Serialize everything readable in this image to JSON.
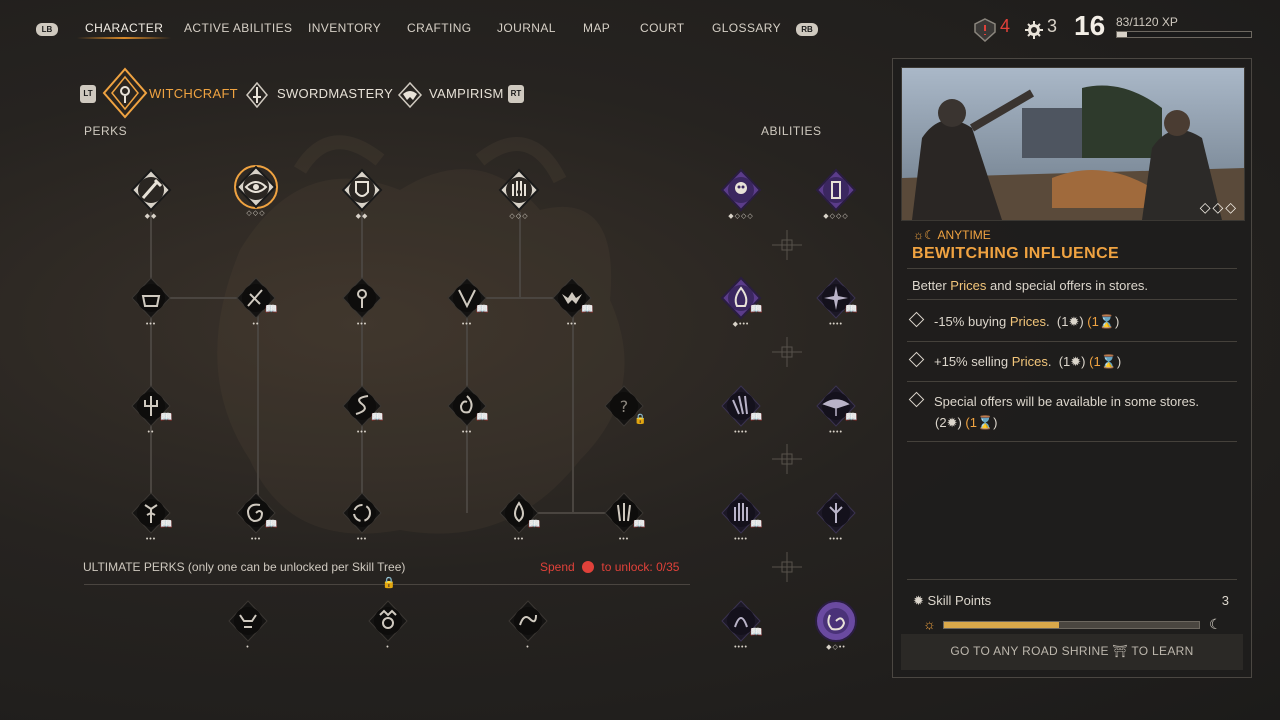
{
  "top_nav": {
    "left_bumper": "LB",
    "right_bumper": "RB",
    "tabs": [
      "CHARACTER",
      "ACTIVE ABILITIES",
      "INVENTORY",
      "CRAFTING",
      "JOURNAL",
      "MAP",
      "COURT",
      "GLOSSARY"
    ],
    "active_tab": "CHARACTER"
  },
  "stats": {
    "alert_count": "4",
    "skill_points": "3",
    "level": "16",
    "xp": "83/1120 XP",
    "xp_fraction": 0.074
  },
  "tree_tabs": {
    "left_trigger": "LT",
    "right_trigger": "RT",
    "items": [
      "WITCHCRAFT",
      "SWORDMASTERY",
      "VAMPIRISM"
    ],
    "active": "WITCHCRAFT"
  },
  "labels": {
    "perks": "PERKS",
    "abilities": "ABILITIES",
    "ultimate": "ULTIMATE PERKS (only one can be unlocked per Skill Tree)",
    "spend_prefix": "Spend",
    "spend_suffix": "to unlock: 0/35"
  },
  "detail": {
    "timing": "ANYTIME",
    "title": "BEWITCHING INFLUENCE",
    "desc_pre": "Better ",
    "desc_hl": "Prices",
    "desc_post": " and special offers in stores.",
    "effects": [
      {
        "pre": "-15% buying ",
        "hl": "Prices",
        "post": ".",
        "cost": "(1",
        "time": "(1"
      },
      {
        "pre": "+15% selling ",
        "hl": "Prices",
        "post": ".",
        "cost": "(1",
        "time": "(1"
      },
      {
        "pre": "Special offers will be available in some stores.",
        "hl": "",
        "post": "",
        "cost": "(2",
        "time": "(1"
      }
    ],
    "skill_points_label": "Skill Points",
    "skill_points_value": "3",
    "footer_pre": "GO TO ANY ROAD SHRINE",
    "footer_post": "TO LEARN",
    "day_progress": 0.45
  },
  "colors": {
    "accent": "#f0a341",
    "red": "#e0413a",
    "purple": "#5b3c8a"
  }
}
